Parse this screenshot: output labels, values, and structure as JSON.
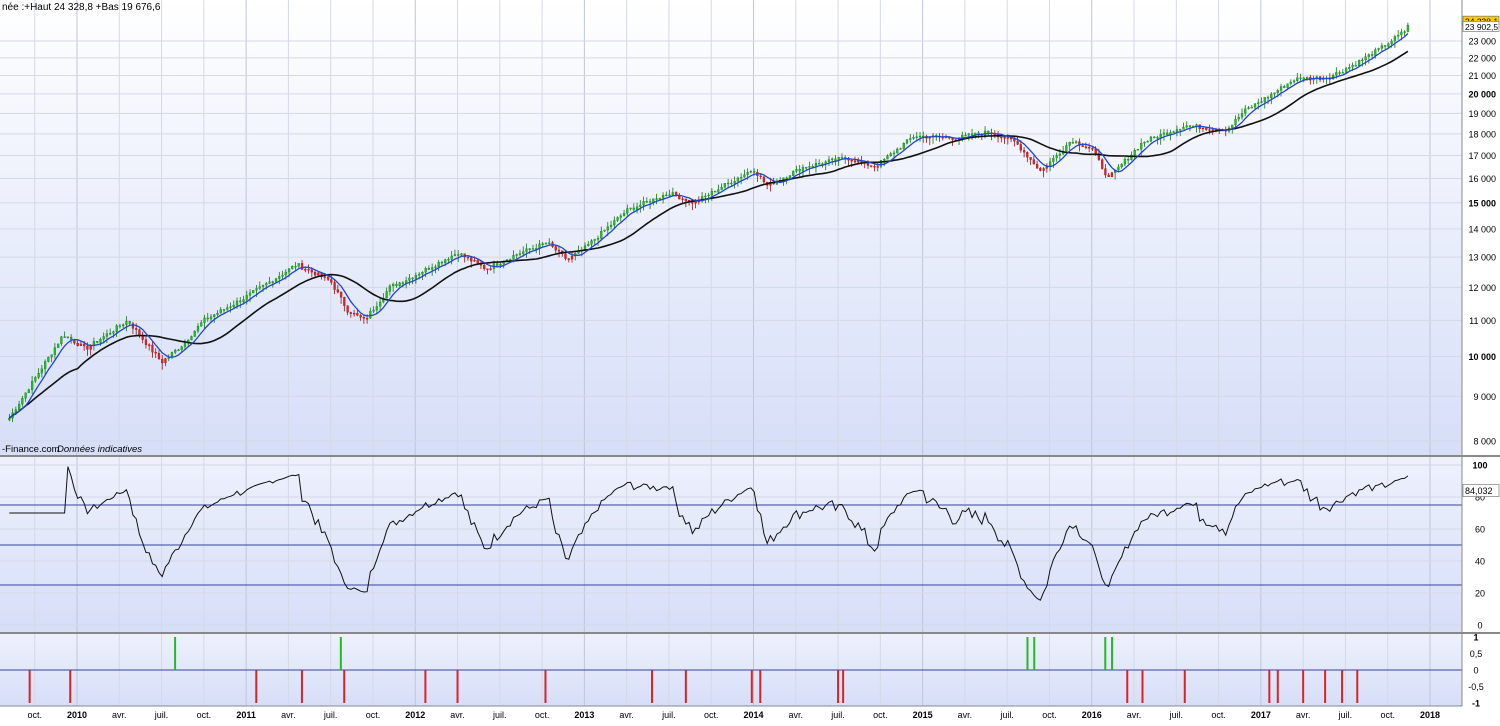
{
  "header": {
    "stats_text": "née :+Haut 24 328,8 +Bas 19 676,6",
    "watermark": "-Finance.com",
    "disclaimer": "Données indicatives"
  },
  "colors": {
    "up": "#22bb22",
    "down": "#dd2222",
    "ma_fast": "#2244cc",
    "ma_slow": "#111111",
    "rsi_line": "#111111",
    "ref_line": "#334499",
    "price_flag": "#ffcc00"
  },
  "chart_data": [
    {
      "type": "candlestick",
      "name": "price",
      "series_names": [],
      "x_start": 2009.6,
      "x_end": 2017.88,
      "y_scale": "log",
      "ylim": [
        7700,
        24500
      ],
      "grid": true,
      "y_ticks": [
        8000,
        9000,
        10000,
        11000,
        12000,
        13000,
        14000,
        15000,
        16000,
        17000,
        18000,
        19000,
        20000,
        21000,
        22000,
        23000
      ],
      "y_tick_labels": [
        "8 000",
        "9 000",
        "10 000",
        "11 000",
        "12 000",
        "13 000",
        "14 000",
        "15 000",
        "16 000",
        "17 000",
        "18 000",
        "19 000",
        "20 000",
        "21 000",
        "22 000",
        "23 000"
      ],
      "last_price_labels": [
        "24 238,1",
        "23 902,5"
      ],
      "anchors": [
        [
          2009.6,
          8500
        ],
        [
          2009.92,
          10600
        ],
        [
          2010.05,
          10200
        ],
        [
          2010.3,
          11000
        ],
        [
          2010.5,
          9850
        ],
        [
          2010.62,
          10300
        ],
        [
          2010.75,
          11000
        ],
        [
          2011.0,
          11700
        ],
        [
          2011.3,
          12750
        ],
        [
          2011.5,
          12200
        ],
        [
          2011.6,
          11300
        ],
        [
          2011.7,
          11000
        ],
        [
          2011.85,
          12000
        ],
        [
          2012.0,
          12400
        ],
        [
          2012.25,
          13150
        ],
        [
          2012.42,
          12600
        ],
        [
          2012.6,
          13100
        ],
        [
          2012.78,
          13500
        ],
        [
          2012.9,
          12900
        ],
        [
          2013.0,
          13300
        ],
        [
          2013.25,
          14700
        ],
        [
          2013.5,
          15400
        ],
        [
          2013.65,
          15000
        ],
        [
          2013.8,
          15600
        ],
        [
          2014.0,
          16400
        ],
        [
          2014.08,
          15700
        ],
        [
          2014.3,
          16500
        ],
        [
          2014.55,
          16900
        ],
        [
          2014.72,
          16500
        ],
        [
          2014.95,
          17900
        ],
        [
          2015.2,
          17800
        ],
        [
          2015.4,
          18100
        ],
        [
          2015.55,
          17600
        ],
        [
          2015.7,
          16300
        ],
        [
          2015.88,
          17700
        ],
        [
          2016.0,
          17300
        ],
        [
          2016.1,
          16000
        ],
        [
          2016.3,
          17600
        ],
        [
          2016.55,
          18400
        ],
        [
          2016.8,
          18200
        ],
        [
          2016.9,
          19100
        ],
        [
          2017.05,
          19900
        ],
        [
          2017.2,
          20800
        ],
        [
          2017.4,
          20900
        ],
        [
          2017.55,
          21600
        ],
        [
          2017.7,
          22500
        ],
        [
          2017.85,
          23600
        ],
        [
          2017.88,
          24238
        ]
      ]
    },
    {
      "type": "line",
      "name": "rsi",
      "ylim": [
        0,
        100
      ],
      "y_ticks": [
        0,
        20,
        40,
        60,
        80,
        100
      ],
      "y_tick_labels": [
        "0",
        "20",
        "40",
        "60",
        "80",
        "100"
      ],
      "reference_levels": [
        75,
        50,
        25
      ],
      "last_value_label": "84,032"
    },
    {
      "type": "bar",
      "name": "signal",
      "ylim": [
        -1.1,
        1.1
      ],
      "y_ticks": [
        1,
        0.5,
        0,
        -0.5,
        -1
      ],
      "y_tick_labels": [
        "1",
        "0,5",
        "0",
        "-0,5",
        "-1"
      ],
      "buy_signals": [
        2010.58,
        2011.56,
        2015.62,
        2015.66,
        2016.08,
        2016.12
      ],
      "sell_signals": [
        2009.72,
        2009.96,
        2011.06,
        2011.33,
        2011.58,
        2012.06,
        2012.25,
        2012.77,
        2013.4,
        2013.6,
        2013.99,
        2014.04,
        2014.5,
        2014.53,
        2016.21,
        2016.3,
        2016.55,
        2017.05,
        2017.1,
        2017.25,
        2017.38,
        2017.48,
        2017.57
      ],
      "x_ticks": [
        {
          "x": 2009.75,
          "label": "oct.",
          "bold": false
        },
        {
          "x": 2010.0,
          "label": "2010",
          "bold": true
        },
        {
          "x": 2010.25,
          "label": "avr.",
          "bold": false
        },
        {
          "x": 2010.5,
          "label": "juil.",
          "bold": false
        },
        {
          "x": 2010.75,
          "label": "oct.",
          "bold": false
        },
        {
          "x": 2011.0,
          "label": "2011",
          "bold": true
        },
        {
          "x": 2011.25,
          "label": "avr.",
          "bold": false
        },
        {
          "x": 2011.5,
          "label": "juil.",
          "bold": false
        },
        {
          "x": 2011.75,
          "label": "oct.",
          "bold": false
        },
        {
          "x": 2012.0,
          "label": "2012",
          "bold": true
        },
        {
          "x": 2012.25,
          "label": "avr.",
          "bold": false
        },
        {
          "x": 2012.5,
          "label": "juil.",
          "bold": false
        },
        {
          "x": 2012.75,
          "label": "oct.",
          "bold": false
        },
        {
          "x": 2013.0,
          "label": "2013",
          "bold": true
        },
        {
          "x": 2013.25,
          "label": "avr.",
          "bold": false
        },
        {
          "x": 2013.5,
          "label": "juil.",
          "bold": false
        },
        {
          "x": 2013.75,
          "label": "oct.",
          "bold": false
        },
        {
          "x": 2014.0,
          "label": "2014",
          "bold": true
        },
        {
          "x": 2014.25,
          "label": "avr.",
          "bold": false
        },
        {
          "x": 2014.5,
          "label": "juil.",
          "bold": false
        },
        {
          "x": 2014.75,
          "label": "oct.",
          "bold": false
        },
        {
          "x": 2015.0,
          "label": "2015",
          "bold": true
        },
        {
          "x": 2015.25,
          "label": "avr.",
          "bold": false
        },
        {
          "x": 2015.5,
          "label": "juil.",
          "bold": false
        },
        {
          "x": 2015.75,
          "label": "oct.",
          "bold": false
        },
        {
          "x": 2016.0,
          "label": "2016",
          "bold": true
        },
        {
          "x": 2016.25,
          "label": "avr.",
          "bold": false
        },
        {
          "x": 2016.5,
          "label": "juil.",
          "bold": false
        },
        {
          "x": 2016.75,
          "label": "oct.",
          "bold": false
        },
        {
          "x": 2017.0,
          "label": "2017",
          "bold": true
        },
        {
          "x": 2017.25,
          "label": "avr.",
          "bold": false
        },
        {
          "x": 2017.5,
          "label": "juil.",
          "bold": false
        },
        {
          "x": 2017.75,
          "label": "oct.",
          "bold": false
        },
        {
          "x": 2018.0,
          "label": "2018",
          "bold": true
        }
      ]
    }
  ]
}
